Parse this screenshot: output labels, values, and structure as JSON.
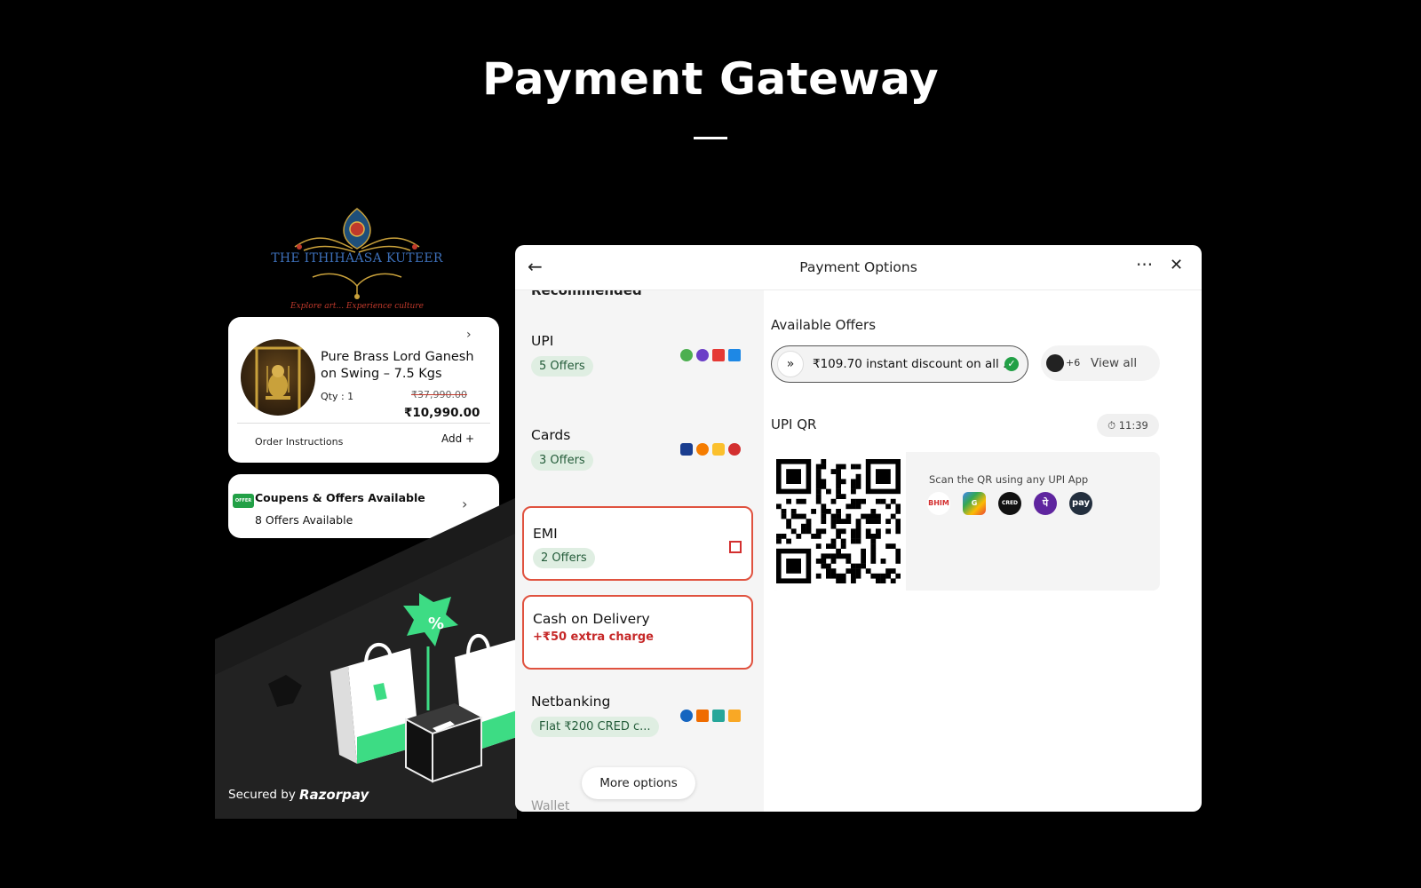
{
  "page": {
    "title": "Payment Gateway"
  },
  "brand": {
    "name": "THE ITHIHAASA KUTEER",
    "tagline": "Explore art... Experience culture"
  },
  "product": {
    "name": "Pure Brass Lord Ganesh on Swing – 7.5 Kgs",
    "qty": "Qty : 1",
    "old_price": "₹37,990.00",
    "price": "₹10,990.00",
    "order_instructions": "Order Instructions",
    "add_label": "Add +"
  },
  "coupons": {
    "tag": "OFFER",
    "title": "Coupens & Offers Available",
    "subtitle": "8 Offers Available"
  },
  "footer": {
    "secured": "Secured by",
    "brand": "Razorpay"
  },
  "payment": {
    "title": "Payment Options",
    "recommended": "Recommended",
    "methods": [
      {
        "label": "UPI",
        "pill": "5 Offers"
      },
      {
        "label": "Cards",
        "pill": "3 Offers"
      },
      {
        "label": "EMI",
        "pill": "2 Offers"
      },
      {
        "label": "Cash on Delivery",
        "note": "+₹50 extra charge"
      },
      {
        "label": "Netbanking",
        "pill": "Flat ₹200 CRED c..."
      }
    ],
    "more_options": "More options",
    "wallet": "Wallet",
    "offers_heading": "Available Offers",
    "offer_text": "₹109.70 instant discount on all ...",
    "view_all_count": "+6",
    "view_all": "View all",
    "upi_qr": "UPI QR",
    "timer": "11:39",
    "scan_text": "Scan the QR using any UPI App",
    "apps": [
      "BHIM",
      "G",
      "CRED",
      "पे",
      "pay"
    ]
  },
  "colors": {
    "accent_red": "#e0523f",
    "offer_green": "#22a046",
    "pill_bg": "#dfeee2"
  }
}
